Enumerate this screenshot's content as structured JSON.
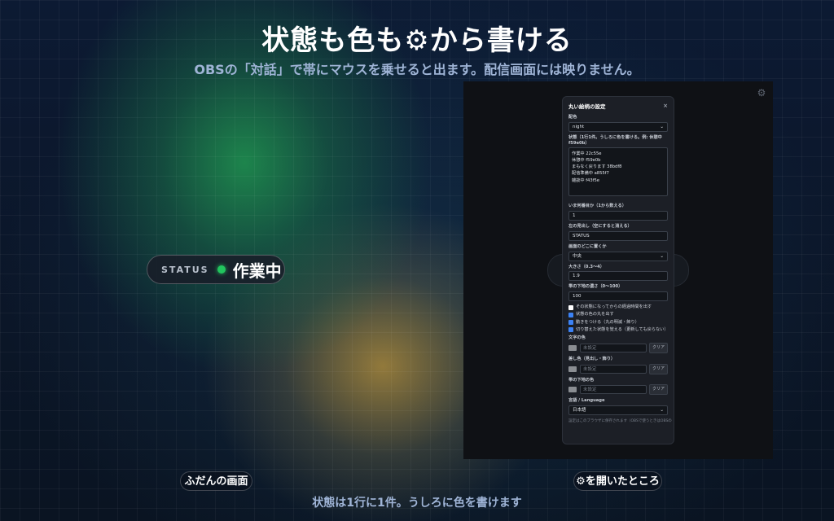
{
  "title": "状態も色も⚙から書ける",
  "subtitle": "OBSの「対話」で帯にマウスを乗せると出ます。配信画面には映りません。",
  "pill": {
    "heading": "STATUS",
    "state": "作業中",
    "dot_color": "#22c55e"
  },
  "preview_gear_icon": "gear-icon",
  "panel": {
    "title": "丸い絵柄の設定",
    "close": "×",
    "theme_label": "配色",
    "theme_value": "night",
    "status_label": "状態（1行1件。うしろに色を書ける。例: 休憩中 f59e0b）",
    "status_text": "作業中 22c55e\n休憩中 f59e0b\nまもなく戻ります 38bdf8\n配信準備中 a855f7\n雑談中 f43f5e",
    "index_label": "いま何番目か（1から数える）",
    "index_value": "1",
    "heading_label": "左の見出し（空にすると消える）",
    "heading_value": "STATUS",
    "position_label": "画面のどこに置くか",
    "position_value": "中央",
    "size_label": "大きさ（0.3〜4）",
    "size_value": "1.9",
    "opacity_label": "帯の下地の濃さ（0〜100）",
    "opacity_value": "100",
    "checkboxes": [
      {
        "label": "その状態になってからの経過時間を出す",
        "checked": false
      },
      {
        "label": "状態の色の丸を出す",
        "checked": true
      },
      {
        "label": "動きをつける（丸の明滅・飾り）",
        "checked": true
      },
      {
        "label": "切り替えた状態を覚える（更新しても戻らない）",
        "checked": true
      }
    ],
    "text_color_label": "文字の色",
    "accent_color_label": "差し色（見出し・飾り）",
    "bg_color_label": "帯の下地の色",
    "unset_placeholder": "未設定",
    "clear_label": "クリア",
    "language_label": "言語 / Language",
    "language_value": "日本語",
    "footer": "設定はこのブラウザに保存されます（OBSで使うときはOBSの"
  },
  "caption_left": "ふだんの画面",
  "caption_right": "⚙を開いたところ",
  "bottom_note": "状態は1行に1件。うしろに色を書けます"
}
